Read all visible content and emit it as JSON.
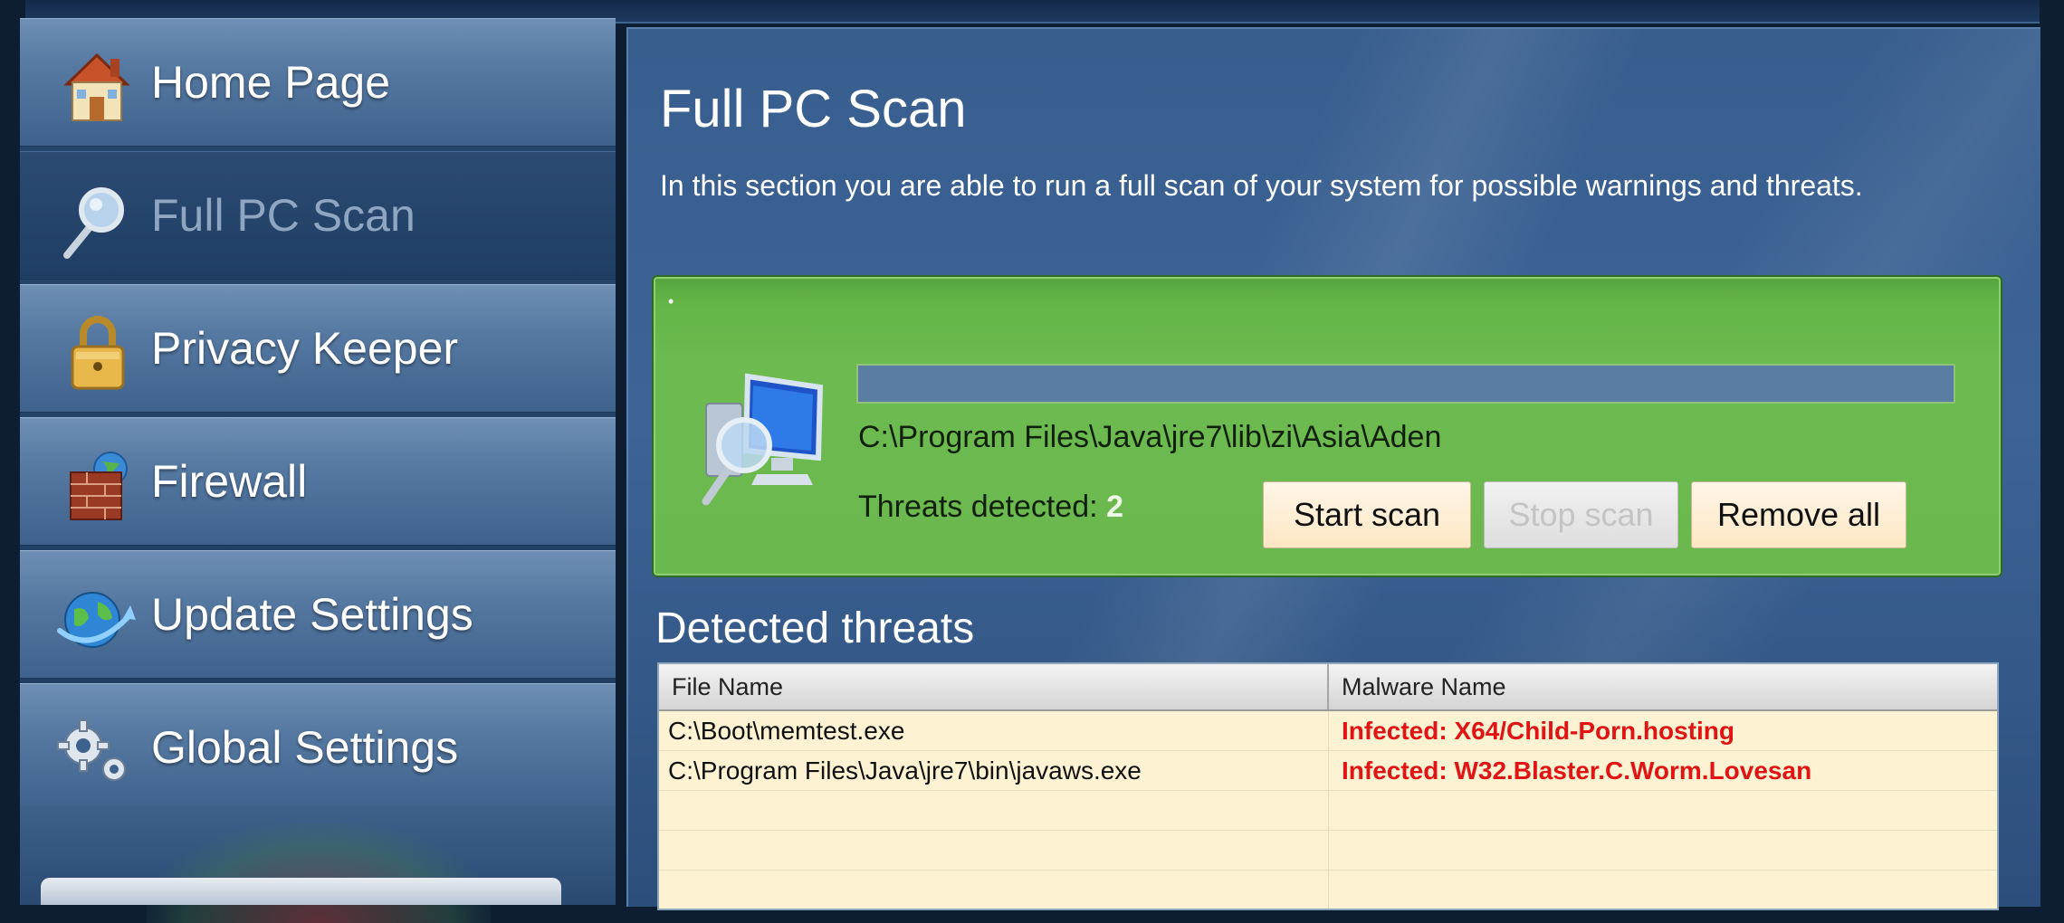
{
  "sidebar": {
    "items": [
      {
        "label": "Home Page",
        "icon": "house-icon",
        "active": false
      },
      {
        "label": "Full PC Scan",
        "icon": "magnifier-icon",
        "active": true
      },
      {
        "label": "Privacy Keeper",
        "icon": "padlock-icon",
        "active": false
      },
      {
        "label": "Firewall",
        "icon": "brick-wall-globe-icon",
        "active": false
      },
      {
        "label": "Update Settings",
        "icon": "globe-update-icon",
        "active": false
      },
      {
        "label": "Global Settings",
        "icon": "gears-icon",
        "active": false
      }
    ]
  },
  "main": {
    "title": "Full PC Scan",
    "description": "In this section you are able to run a full scan of your system for possible warnings and threats.",
    "scan": {
      "current_file": "C:\\Program Files\\Java\\jre7\\lib\\zi\\Asia\\Aden",
      "threats_label": "Threats detected:",
      "threats_count": "2",
      "start_button": "Start scan",
      "stop_button": "Stop scan",
      "remove_button": "Remove all",
      "progress": 1.0
    },
    "threats_section": {
      "title": "Detected threats",
      "columns": [
        "File Name",
        "Malware Name"
      ],
      "rows": [
        {
          "file": "C:\\Boot\\memtest.exe",
          "malware": "Infected: X64/Child-Porn.hosting"
        },
        {
          "file": "C:\\Program Files\\Java\\jre7\\bin\\javaws.exe",
          "malware": "Infected: W32.Blaster.C.Worm.Lovesan"
        },
        {
          "file": "",
          "malware": ""
        },
        {
          "file": "",
          "malware": ""
        },
        {
          "file": "",
          "malware": ""
        }
      ]
    }
  },
  "colors": {
    "scan_panel_green": "#6ab84e",
    "malware_text_red": "#e01414",
    "table_background": "#fdf3d3"
  }
}
